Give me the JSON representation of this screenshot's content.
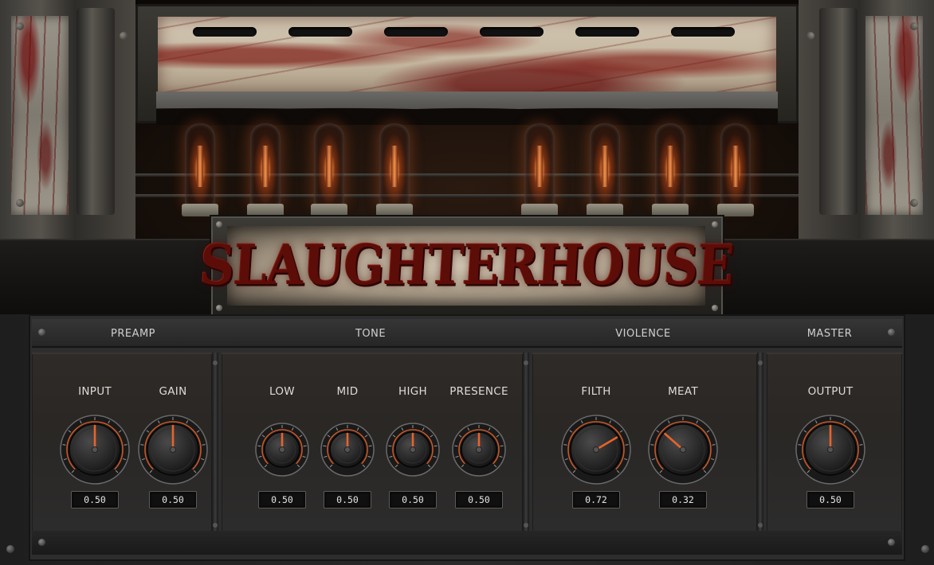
{
  "app": {
    "logo_text": "SLAUGHTERHOUSE",
    "accent_color": "#e8632a"
  },
  "sections": {
    "preamp": "PREAMP",
    "tone": "TONE",
    "violence": "VIOLENCE",
    "master": "MASTER"
  },
  "knobs": {
    "input": {
      "label": "INPUT",
      "value": "0.50",
      "level": 0.5
    },
    "gain": {
      "label": "GAIN",
      "value": "0.50",
      "level": 0.5
    },
    "low": {
      "label": "LOW",
      "value": "0.50",
      "level": 0.5
    },
    "mid": {
      "label": "MID",
      "value": "0.50",
      "level": 0.5
    },
    "high": {
      "label": "HIGH",
      "value": "0.50",
      "level": 0.5
    },
    "presence": {
      "label": "PRESENCE",
      "value": "0.50",
      "level": 0.5
    },
    "filth": {
      "label": "FILTH",
      "value": "0.72",
      "level": 0.72
    },
    "meat": {
      "label": "MEAT",
      "value": "0.32",
      "level": 0.32
    },
    "output": {
      "label": "OUTPUT",
      "value": "0.50",
      "level": 0.5
    }
  }
}
